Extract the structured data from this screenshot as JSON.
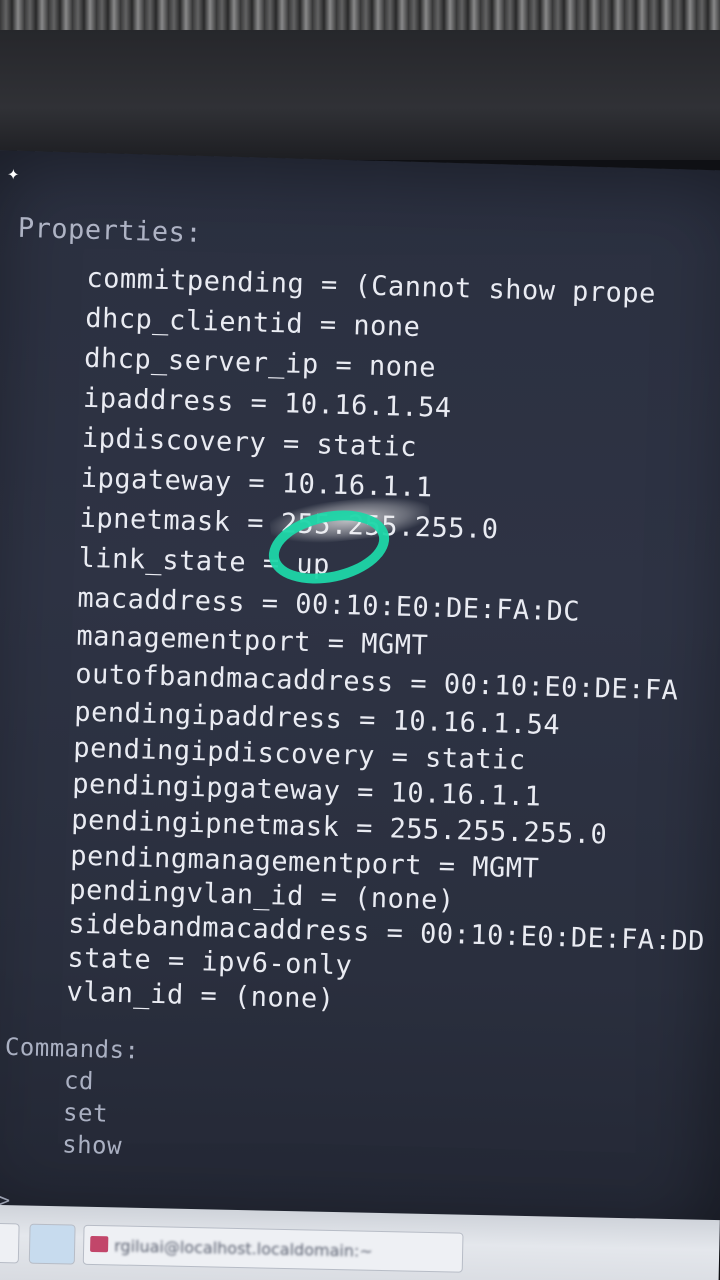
{
  "terminal": {
    "properties_header": "Properties:",
    "properties": [
      "commitpending = (Cannot show prope",
      "dhcp_clientid = none",
      "dhcp_server_ip = none",
      "ipaddress = 10.16.1.54",
      "ipdiscovery = static",
      "ipgateway = 10.16.1.1",
      "ipnetmask = 255.255.255.0",
      "link_state = up",
      "macaddress = 00:10:E0:DE:FA:DC",
      "managementport = MGMT",
      "outofbandmacaddress = 00:10:E0:DE:FA",
      "pendingipaddress = 10.16.1.54",
      "pendingipdiscovery = static",
      "pendingipgateway = 10.16.1.1",
      "pendingipnetmask = 255.255.255.0",
      "pendingmanagementport = MGMT",
      "pendingvlan_id = (none)",
      "sidebandmacaddress = 00:10:E0:DE:FA:DD",
      "state = ipv6-only",
      "vlan_id = (none)"
    ],
    "commands_header": "Commands:",
    "commands": [
      "cd",
      "set",
      "show"
    ],
    "prompt": ">"
  },
  "taskbar": {
    "app_label": "rgiluai@localhost.localdomain:~"
  },
  "annotation": {
    "circle_color": "#1ed6a8",
    "circled_property": "link_state = up"
  },
  "colors": {
    "terminal_bg": "#2e3344",
    "terminal_text": "#e9ebf2",
    "header_text": "#aeb3c4"
  },
  "icons": {
    "pin": "pin-icon",
    "app": "terminal-app-icon"
  }
}
